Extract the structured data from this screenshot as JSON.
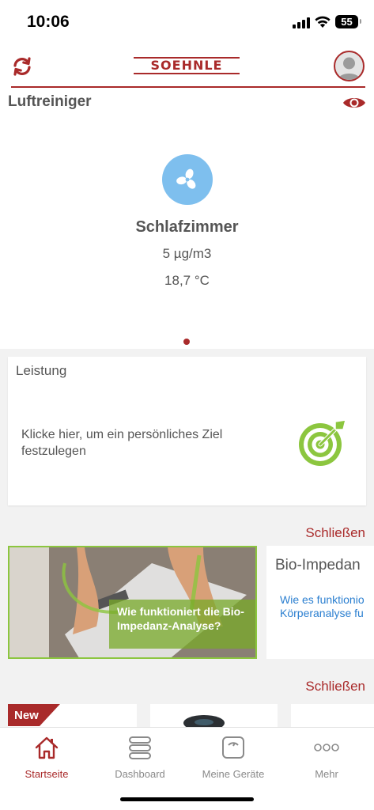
{
  "status_bar": {
    "time": "10:06",
    "battery": "55"
  },
  "header": {
    "logo_text": "SOEHNLE"
  },
  "section": {
    "title": "Luftreiniger"
  },
  "device": {
    "icon": "fan-icon",
    "name": "Schlafzimmer",
    "pm": "5 µg/m3",
    "temperature": "18,7 °C",
    "page_index": 1,
    "page_count": 1
  },
  "performance_card": {
    "title": "Leistung",
    "text": "Klicke hier, um ein persönliches Ziel festzulegen",
    "icon": "target-icon"
  },
  "promo": {
    "close_label": "Schließen",
    "image_caption": "Wie funktioniert die Bio-Impedanz-Analyse?",
    "card_title": "Bio-Impedan",
    "card_link_line1": "Wie es funktionio",
    "card_link_line2": "Körperanalyse fu"
  },
  "products": {
    "close_label": "Schließen",
    "new_badge": "New"
  },
  "tab_bar": {
    "tabs": [
      {
        "label": "Startseite",
        "icon": "home-icon",
        "active": true
      },
      {
        "label": "Dashboard",
        "icon": "dashboard-icon",
        "active": false
      },
      {
        "label": "Meine Geräte",
        "icon": "scale-icon",
        "active": false
      },
      {
        "label": "Mehr",
        "icon": "more-icon",
        "active": false
      }
    ]
  },
  "colors": {
    "brand_red": "#a92a2a",
    "device_blue": "#7ebfee",
    "target_green": "#8cc63f",
    "link_blue": "#2b7fd0"
  }
}
